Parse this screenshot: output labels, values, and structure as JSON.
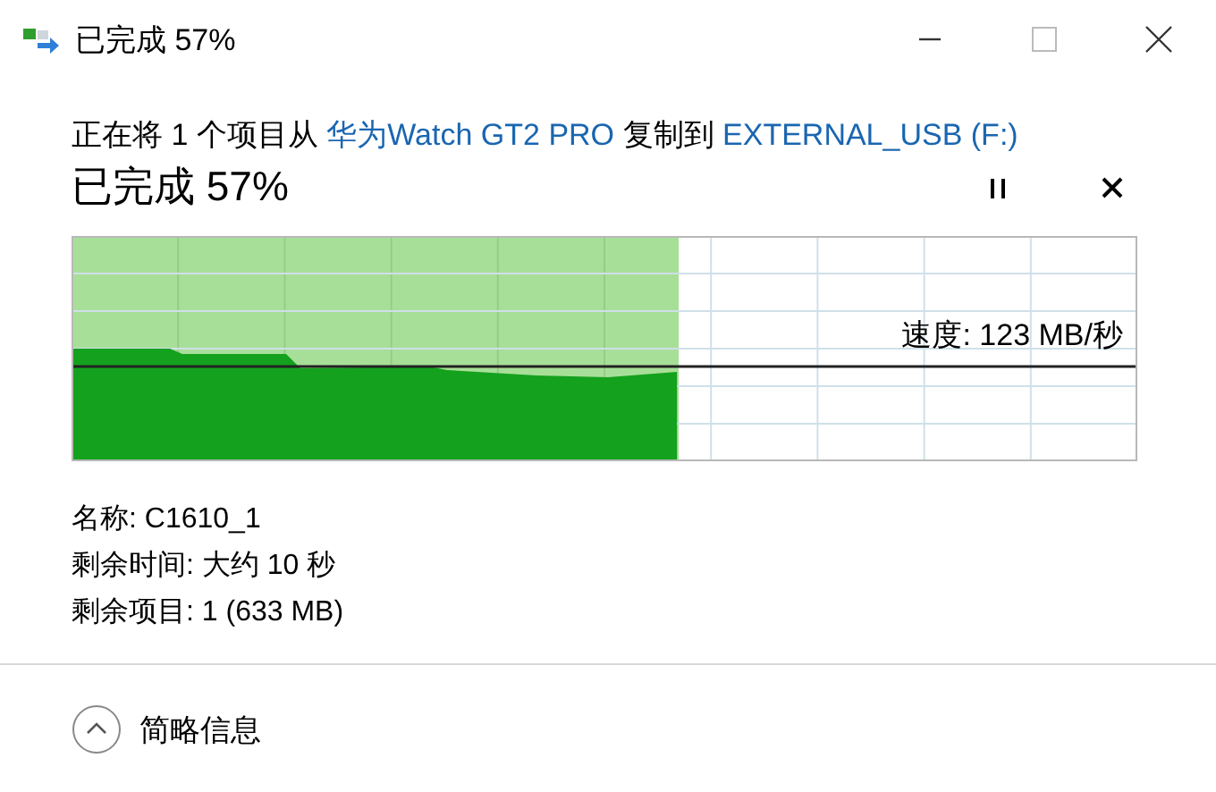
{
  "window": {
    "title": "已完成 57%"
  },
  "message": {
    "prefix": "正在将 1 个项目从",
    "source": "华为Watch GT2 PRO",
    "middle": "复制到",
    "destination": "EXTERNAL_USB (F:)"
  },
  "status": "已完成 57%",
  "progress": {
    "level": 0.57,
    "speed": "速度: 123 MB/秒"
  },
  "details": [
    "名称: C1610_1",
    "剩余时间: 大约 10 秒",
    "剩余项目: 1 (633 MB)"
  ],
  "footer": {
    "label": "简略信息",
    "expanded": true
  }
}
